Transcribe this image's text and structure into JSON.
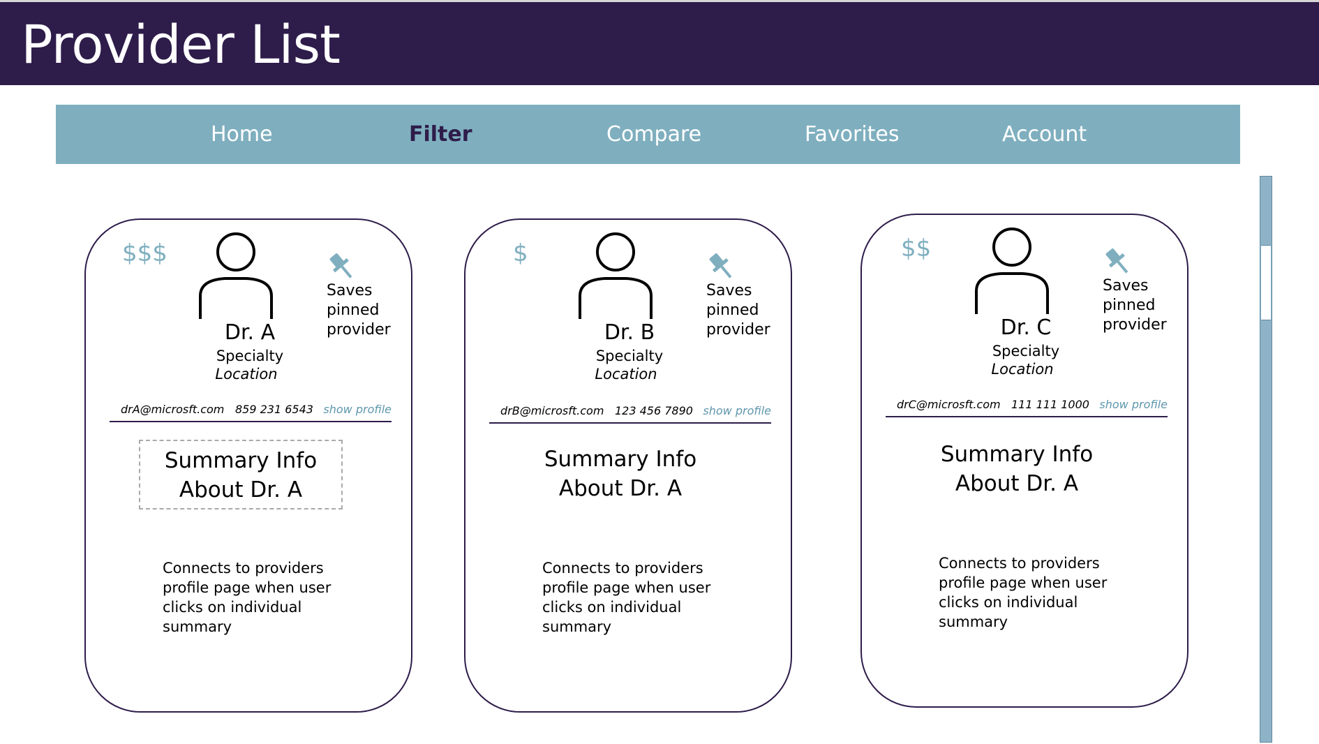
{
  "header": {
    "title": "Provider List"
  },
  "nav": [
    {
      "label": "Home",
      "active": false
    },
    {
      "label": "Filter",
      "active": true
    },
    {
      "label": "Compare",
      "active": false
    },
    {
      "label": "Favorites",
      "active": false
    },
    {
      "label": "Account",
      "active": false
    }
  ],
  "colors": {
    "header_bg": "#2e1c4a",
    "nav_bg": "#7fafbf",
    "accent": "#7fafbf",
    "link": "#5e97ad"
  },
  "cards": [
    {
      "price": "$$$",
      "name": "Dr. A",
      "specialty": "Specialty",
      "location": "Location",
      "email": "drA@microsft.com",
      "phone": "859 231 6543",
      "profile_link": "show profile",
      "pin_note": "Saves pinned provider",
      "summary_line1": "Summary  Info",
      "summary_line2": "About Dr. A",
      "connect_note": "Connects to providers profile page when user clicks on individual summary"
    },
    {
      "price": "$",
      "name": "Dr. B",
      "specialty": "Specialty",
      "location": "Location",
      "email": "drB@microsft.com",
      "phone": "123 456 7890",
      "profile_link": "show profile",
      "pin_note": "Saves pinned provider",
      "summary_line1": "Summary  Info",
      "summary_line2": "About Dr. A",
      "connect_note": "Connects to providers profile page when user clicks on individual summary"
    },
    {
      "price": "$$",
      "name": "Dr. C",
      "specialty": "Specialty",
      "location": "Location",
      "email": "drC@microsft.com",
      "phone": "111 111 1000",
      "profile_link": "show profile",
      "pin_note": "Saves pinned provider",
      "summary_line1": "Summary  Info",
      "summary_line2": "About Dr. A",
      "connect_note": "Connects to providers profile page when user clicks on individual summary"
    }
  ]
}
